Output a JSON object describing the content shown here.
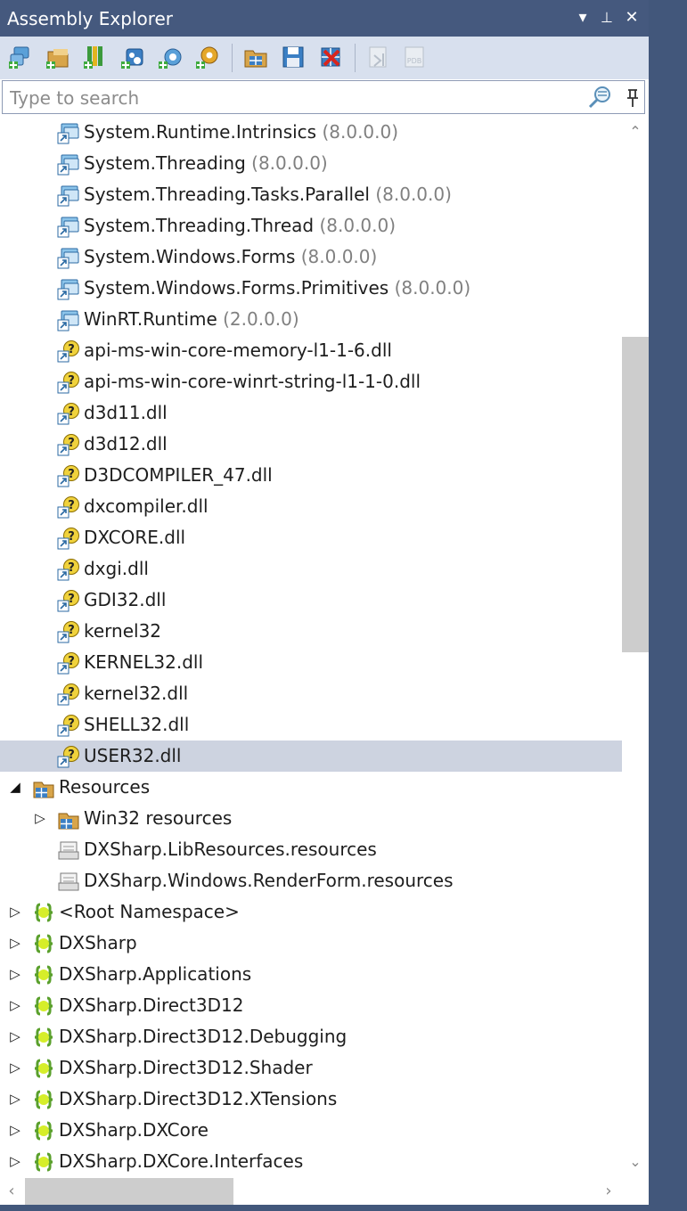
{
  "window": {
    "title": "Assembly Explorer",
    "controls": {
      "dropdown": "▾",
      "pin": "⊥",
      "close": "✕"
    }
  },
  "toolbar": {
    "buttons": [
      {
        "name": "open-assembly-icon"
      },
      {
        "name": "open-folder-icon"
      },
      {
        "name": "open-from-gac-icon"
      },
      {
        "name": "open-from-nuget-icon"
      },
      {
        "name": "open-from-package-icon"
      },
      {
        "name": "settings-icon"
      },
      {
        "name": "assembly-list-icon"
      },
      {
        "name": "save-list-icon"
      },
      {
        "name": "clear-list-icon"
      },
      {
        "name": "open-in-vs-icon-disabled"
      },
      {
        "name": "pdb-icon-disabled",
        "text": "PDB"
      }
    ]
  },
  "search": {
    "placeholder": "Type to search",
    "value": ""
  },
  "tree": {
    "rows": [
      {
        "indent": 2,
        "expander": "",
        "icon": "ref",
        "label": "System.Runtime.Intrinsics",
        "version": "(8.0.0.0)"
      },
      {
        "indent": 2,
        "expander": "",
        "icon": "ref",
        "label": "System.Threading",
        "version": "(8.0.0.0)"
      },
      {
        "indent": 2,
        "expander": "",
        "icon": "ref",
        "label": "System.Threading.Tasks.Parallel",
        "version": "(8.0.0.0)"
      },
      {
        "indent": 2,
        "expander": "",
        "icon": "ref",
        "label": "System.Threading.Thread",
        "version": "(8.0.0.0)"
      },
      {
        "indent": 2,
        "expander": "",
        "icon": "ref",
        "label": "System.Windows.Forms",
        "version": "(8.0.0.0)"
      },
      {
        "indent": 2,
        "expander": "",
        "icon": "ref",
        "label": "System.Windows.Forms.Primitives",
        "version": "(8.0.0.0)"
      },
      {
        "indent": 2,
        "expander": "",
        "icon": "ref",
        "label": "WinRT.Runtime",
        "version": "(2.0.0.0)"
      },
      {
        "indent": 2,
        "expander": "",
        "icon": "native",
        "label": "api-ms-win-core-memory-l1-1-6.dll",
        "version": ""
      },
      {
        "indent": 2,
        "expander": "",
        "icon": "native",
        "label": "api-ms-win-core-winrt-string-l1-1-0.dll",
        "version": ""
      },
      {
        "indent": 2,
        "expander": "",
        "icon": "native",
        "label": "d3d11.dll",
        "version": ""
      },
      {
        "indent": 2,
        "expander": "",
        "icon": "native",
        "label": "d3d12.dll",
        "version": ""
      },
      {
        "indent": 2,
        "expander": "",
        "icon": "native",
        "label": "D3DCOMPILER_47.dll",
        "version": ""
      },
      {
        "indent": 2,
        "expander": "",
        "icon": "native",
        "label": "dxcompiler.dll",
        "version": ""
      },
      {
        "indent": 2,
        "expander": "",
        "icon": "native",
        "label": "DXCORE.dll",
        "version": ""
      },
      {
        "indent": 2,
        "expander": "",
        "icon": "native",
        "label": "dxgi.dll",
        "version": ""
      },
      {
        "indent": 2,
        "expander": "",
        "icon": "native",
        "label": "GDI32.dll",
        "version": ""
      },
      {
        "indent": 2,
        "expander": "",
        "icon": "native",
        "label": "kernel32",
        "version": ""
      },
      {
        "indent": 2,
        "expander": "",
        "icon": "native",
        "label": "KERNEL32.dll",
        "version": ""
      },
      {
        "indent": 2,
        "expander": "",
        "icon": "native",
        "label": "kernel32.dll",
        "version": ""
      },
      {
        "indent": 2,
        "expander": "",
        "icon": "native",
        "label": "SHELL32.dll",
        "version": ""
      },
      {
        "indent": 2,
        "expander": "",
        "icon": "native",
        "label": "USER32.dll",
        "version": "",
        "selected": true
      },
      {
        "indent": 1,
        "expander": "◢",
        "icon": "resources",
        "label": "Resources",
        "version": ""
      },
      {
        "indent": 2,
        "expander": "▷",
        "icon": "resources",
        "label": "Win32 resources",
        "version": ""
      },
      {
        "indent": 2,
        "expander": "",
        "icon": "resfile",
        "label": "DXSharp.LibResources.resources",
        "version": ""
      },
      {
        "indent": 2,
        "expander": "",
        "icon": "resfile",
        "label": "DXSharp.Windows.RenderForm.resources",
        "version": ""
      },
      {
        "indent": 1,
        "expander": "▷",
        "icon": "namespace",
        "label": "<Root Namespace>",
        "version": ""
      },
      {
        "indent": 1,
        "expander": "▷",
        "icon": "namespace",
        "label": "DXSharp",
        "version": ""
      },
      {
        "indent": 1,
        "expander": "▷",
        "icon": "namespace",
        "label": "DXSharp.Applications",
        "version": ""
      },
      {
        "indent": 1,
        "expander": "▷",
        "icon": "namespace",
        "label": "DXSharp.Direct3D12",
        "version": ""
      },
      {
        "indent": 1,
        "expander": "▷",
        "icon": "namespace",
        "label": "DXSharp.Direct3D12.Debugging",
        "version": ""
      },
      {
        "indent": 1,
        "expander": "▷",
        "icon": "namespace",
        "label": "DXSharp.Direct3D12.Shader",
        "version": ""
      },
      {
        "indent": 1,
        "expander": "▷",
        "icon": "namespace",
        "label": "DXSharp.Direct3D12.XTensions",
        "version": ""
      },
      {
        "indent": 1,
        "expander": "▷",
        "icon": "namespace",
        "label": "DXSharp.DXCore",
        "version": ""
      },
      {
        "indent": 1,
        "expander": "▷",
        "icon": "namespace",
        "label": "DXSharp.DXCore.Interfaces",
        "version": ""
      }
    ]
  },
  "colors": {
    "titlebar": "#45597e",
    "toolbar": "#d8e0ee",
    "selection": "#cdd3e0",
    "version_text": "#808080"
  }
}
